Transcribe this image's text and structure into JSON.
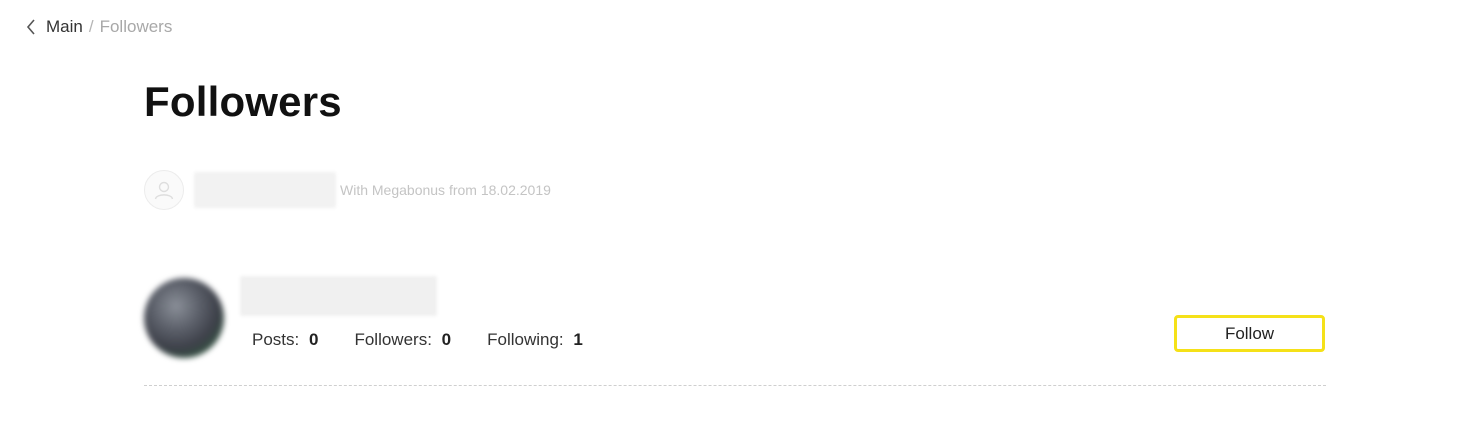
{
  "breadcrumb": {
    "back_icon": "chevron-left-icon",
    "main_label": "Main",
    "separator": "/",
    "current_label": "Followers"
  },
  "page": {
    "title": "Followers"
  },
  "profile": {
    "avatar_icon": "user-icon",
    "since_text": "With Megabonus from 18.02.2019"
  },
  "followers": [
    {
      "posts_label": "Posts:",
      "posts_value": "0",
      "followers_label": "Followers:",
      "followers_value": "0",
      "following_label": "Following:",
      "following_value": "1",
      "follow_button_label": "Follow"
    }
  ],
  "colors": {
    "follow_button_border": "#f5e118",
    "muted_text": "#c4c4c4",
    "divider": "#cfcfcf"
  }
}
